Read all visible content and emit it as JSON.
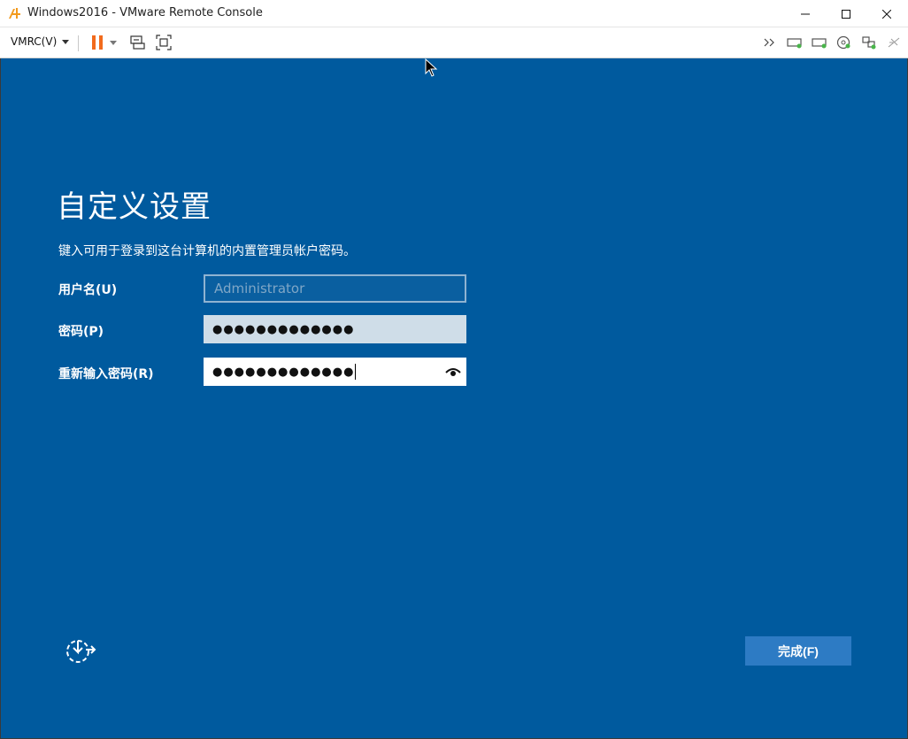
{
  "window": {
    "title": "Windows2016 - VMware Remote Console"
  },
  "toolbar": {
    "menu_label": "VMRC(V)",
    "icons": [
      "pause-icon",
      "send-keys-icon",
      "fullscreen-icon",
      "overflow-icon",
      "disk1-icon",
      "disk2-icon",
      "cd-icon",
      "network-icon",
      "usb-icon"
    ]
  },
  "setup": {
    "heading": "自定义设置",
    "instruction": "键入可用于登录到这台计算机的内置管理员帐户密码。",
    "username_label": "用户名(U)",
    "username_placeholder": "Administrator",
    "password_label": "密码(P)",
    "password_value": "●●●●●●●●●●●●●",
    "confirm_label": "重新输入密码(R)",
    "confirm_value": "●●●●●●●●●●●●●",
    "finish_label": "完成(F)"
  },
  "colors": {
    "background": "#005a9e",
    "button": "#2d7bc4",
    "pause": "#f26b1d"
  }
}
